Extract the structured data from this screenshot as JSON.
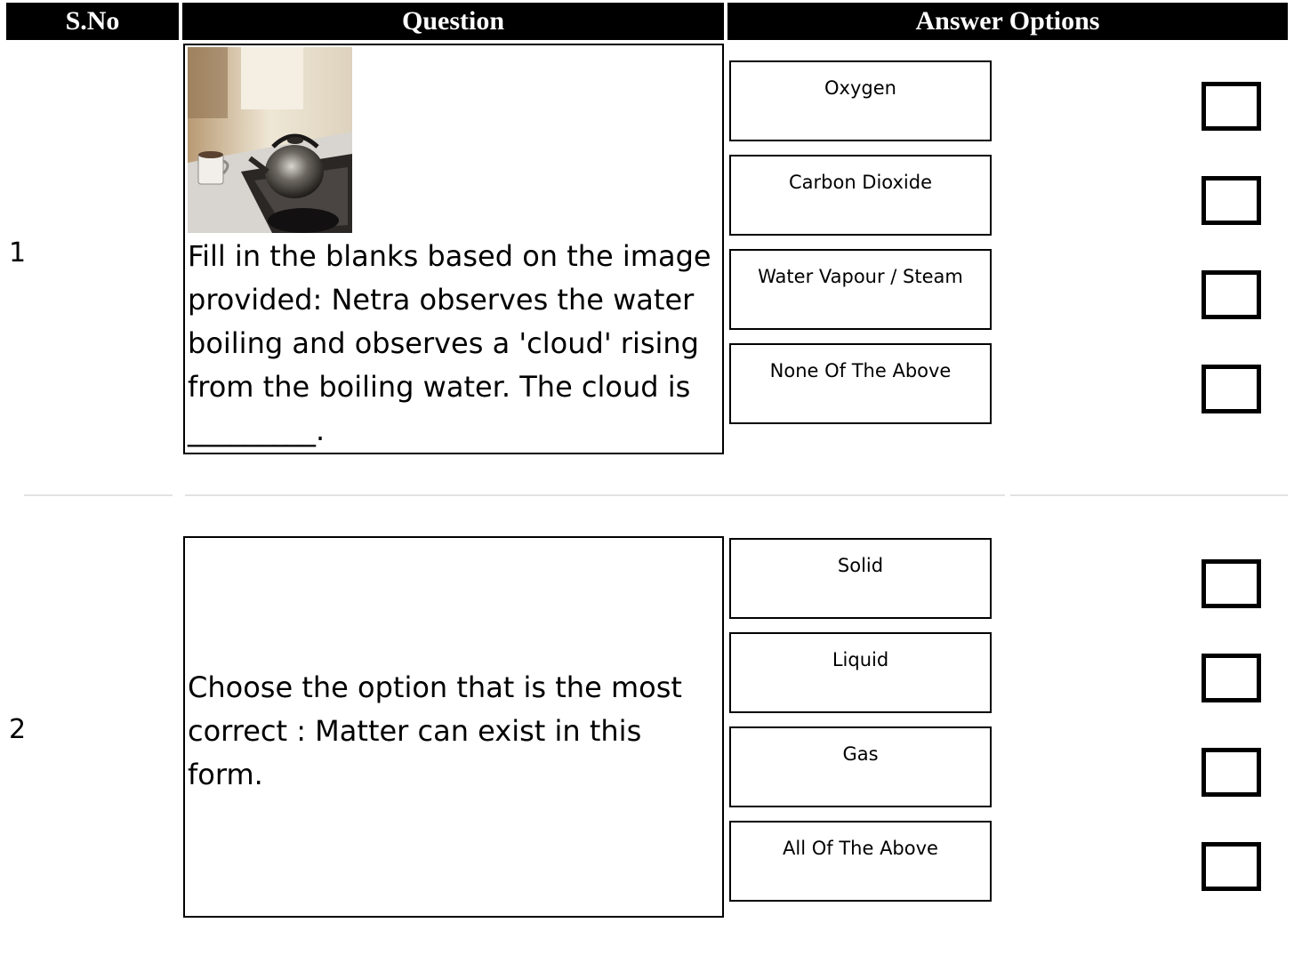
{
  "table": {
    "headers": {
      "sno": "S.No",
      "question": "Question",
      "answer_options": "Answer Options"
    }
  },
  "questions": [
    {
      "number": "1",
      "has_image": true,
      "image_subject": "kettle-on-stove",
      "text": "Fill in the blanks based on the image provided: Netra observes the water boiling and observes a 'cloud' rising from the boiling water. The cloud is _________.",
      "options": [
        "Oxygen",
        "Carbon Dioxide",
        "Water Vapour / Steam",
        "None Of The Above"
      ]
    },
    {
      "number": "2",
      "has_image": false,
      "text": "Choose the option that is the most correct : Matter can exist in this form.",
      "options": [
        "Solid",
        "Liquid",
        "Gas",
        "All Of The Above"
      ]
    }
  ]
}
